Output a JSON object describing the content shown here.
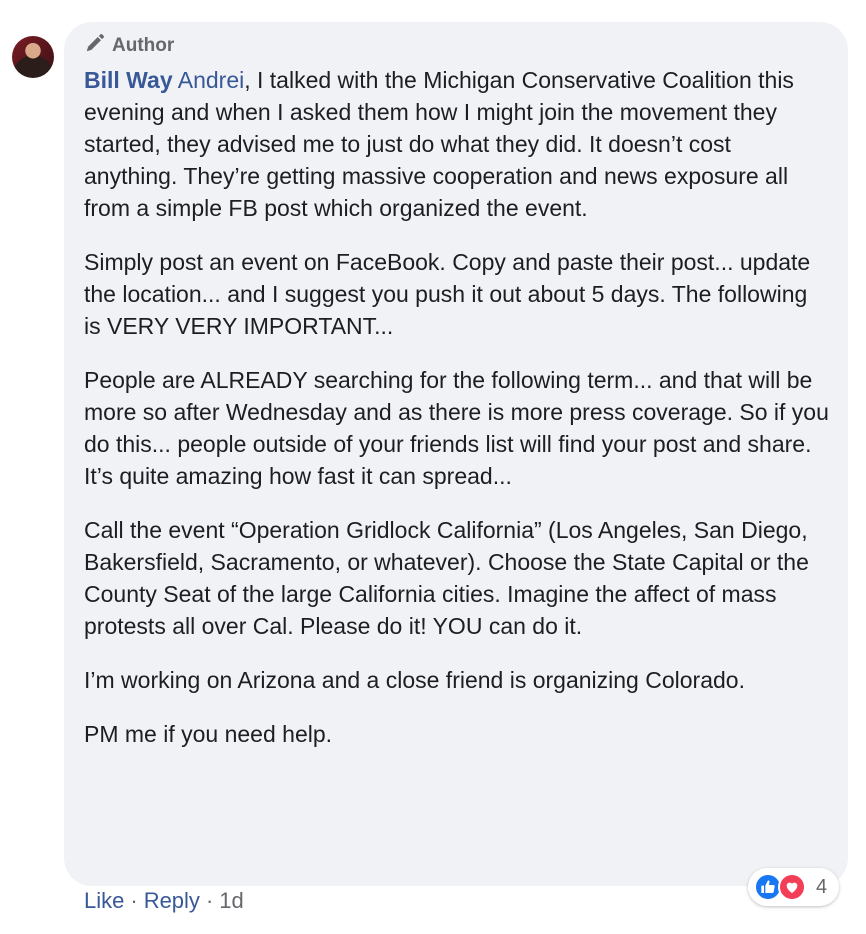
{
  "comment": {
    "author_badge": "Author",
    "author_name": "Bill Way",
    "mention": "Andrei",
    "first_text": ", I talked with the Michigan Conservative Coalition this evening and when I asked them how I might join the movement they started, they advised me to just do what they did. It doesn’t cost anything. They’re getting massive cooperation and news exposure all from a simple FB post which organized the event.",
    "paragraphs": [
      "Simply post an event on FaceBook. Copy and paste their post... update the location... and I suggest you push it out about 5 days. The following is VERY VERY IMPORTANT...",
      "People are ALREADY searching for the following term... and that will be more so after Wednesday and as there is more press coverage. So if you do this... people outside of your friends list will find your post and share. It’s quite amazing how fast it can spread...",
      "Call the event “Operation Gridlock California” (Los Angeles, San Diego, Bakersfield, Sacramento, or whatever). Choose the State Capital or the County Seat of the large California cities. Imagine the affect of mass protests all over Cal. Please do it! YOU can do it.",
      "I’m working on Arizona and a close friend is organizing Colorado.",
      "PM me if you need help."
    ]
  },
  "actions": {
    "like": "Like",
    "sep1": "·",
    "reply": "Reply",
    "sep2": "·",
    "time": "1d"
  },
  "reactions": {
    "icons": [
      "like-icon",
      "love-icon"
    ],
    "count": "4"
  },
  "colors": {
    "link": "#385898",
    "bubble": "#f0f2f5",
    "meta": "#65676b",
    "like": "#1877f2",
    "love": "#f33e58"
  }
}
